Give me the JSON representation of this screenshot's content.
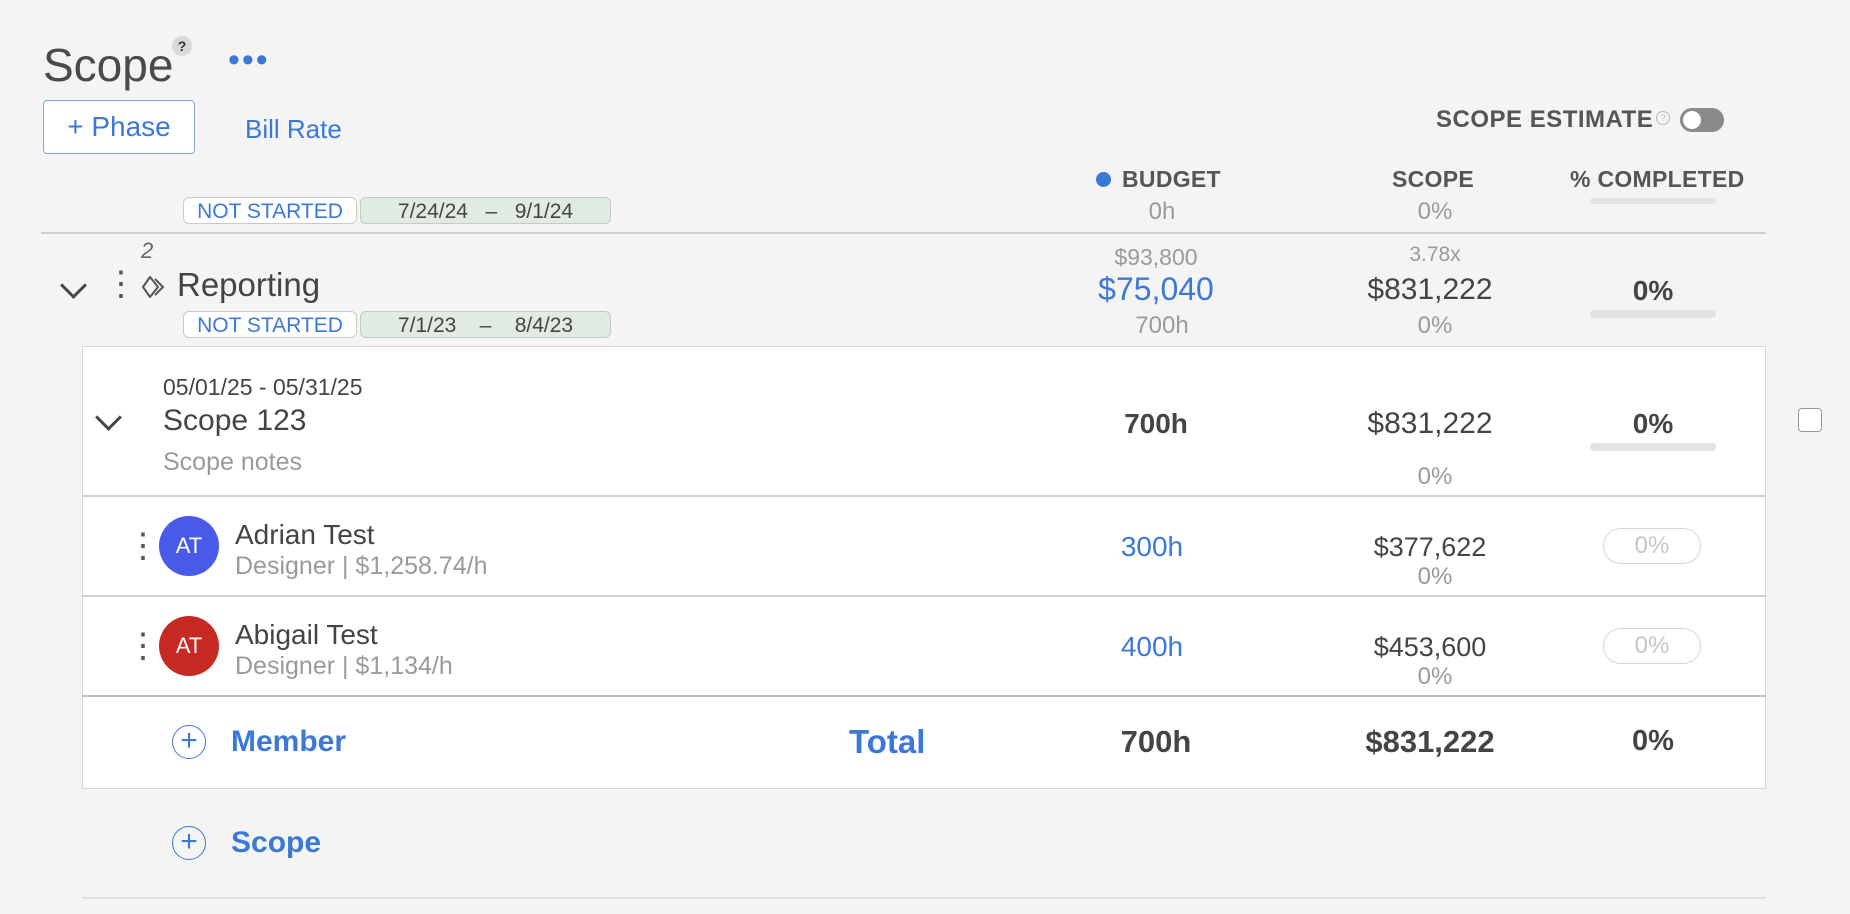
{
  "page": {
    "title": "Scope",
    "help_icon": "question-mark-icon",
    "help_glyph": "?",
    "more_glyph": "•••",
    "add_phase_label": "+ Phase",
    "bill_rate_label": "Bill Rate",
    "scope_estimate_label": "SCOPE ESTIMATE",
    "scope_estimate_help_glyph": "?",
    "scope_estimate_enabled": false
  },
  "columns": {
    "budget": "BUDGET",
    "scope": "SCOPE",
    "completed": "% COMPLETED"
  },
  "colors": {
    "accent": "#3b78d8",
    "avatar_adrian": "#4a5ae8",
    "avatar_abigail": "#c62a22"
  },
  "prev_phase": {
    "status": "NOT STARTED",
    "start": "7/24/24",
    "dash": "–",
    "end": "9/1/24",
    "budget_hours": "0h",
    "scope_pct": "0%"
  },
  "phase": {
    "number": "2",
    "name": "Reporting",
    "status": "NOT STARTED",
    "start": "7/1/23",
    "dash": "–",
    "end": "8/4/23",
    "budget_original": "$93,800",
    "budget": "$75,040",
    "budget_hours": "700h",
    "scope_multiplier": "3.78x",
    "scope_value": "$831,222",
    "scope_pct": "0%",
    "completed_pct": "0%",
    "completed_progress": 0
  },
  "scope_item": {
    "date_range": "05/01/25 - 05/31/25",
    "name": "Scope 123",
    "notes": "Scope notes",
    "hours": "700h",
    "value": "$831,222",
    "value_pct": "0%",
    "completed_pct": "0%",
    "completed_progress": 0
  },
  "members": [
    {
      "initials": "AT",
      "name": "Adrian Test",
      "role_rate": "Designer | $1,258.74/h",
      "hours": "300h",
      "value": "$377,622",
      "value_pct": "0%",
      "completed_pct": "0%"
    },
    {
      "initials": "AT",
      "name": "Abigail Test",
      "role_rate": "Designer | $1,134/h",
      "hours": "400h",
      "value": "$453,600",
      "value_pct": "0%",
      "completed_pct": "0%"
    }
  ],
  "totals": {
    "add_member_label": "Member",
    "total_label": "Total",
    "hours": "700h",
    "value": "$831,222",
    "completed_pct": "0%"
  },
  "add_scope_label": "Scope",
  "plus_glyph": "+",
  "kebab_glyph": "⋮"
}
